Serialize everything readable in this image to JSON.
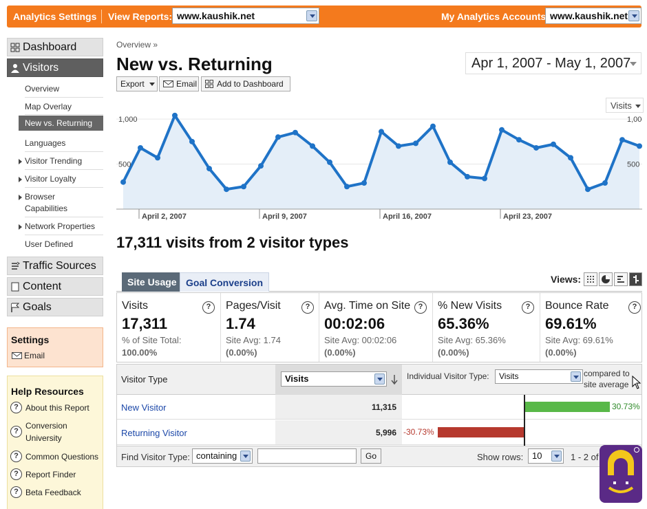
{
  "topbar": {
    "analytics_settings": "Analytics Settings",
    "view_reports_label": "View Reports:",
    "view_reports_value": "www.kaushik.net",
    "accounts_label": "My Analytics Accounts:",
    "accounts_value": "www.kaushik.net"
  },
  "sidebar": {
    "dashboard": "Dashboard",
    "visitors": "Visitors",
    "sub_items": [
      {
        "label": "Overview"
      },
      {
        "label": "Map Overlay"
      },
      {
        "label": "New vs. Returning"
      },
      {
        "label": "Languages"
      },
      {
        "label": "Visitor Trending"
      },
      {
        "label": "Visitor Loyalty"
      },
      {
        "label": "Browser"
      },
      {
        "label": "Capabilities"
      },
      {
        "label": "Network Properties"
      },
      {
        "label": "User Defined"
      }
    ],
    "traffic_sources": "Traffic Sources",
    "content": "Content",
    "goals": "Goals",
    "settings_title": "Settings",
    "settings_email": "Email",
    "help_title": "Help Resources",
    "help_items": [
      "About this Report",
      "Conversion",
      "University",
      "Common Questions",
      "Report Finder",
      "Beta Feedback"
    ]
  },
  "main": {
    "breadcrumb": "Overview »",
    "title": "New vs. Returning",
    "date_range": "Apr 1, 2007 - May 1, 2007",
    "toolbar": {
      "export": "Export",
      "email": "Email",
      "add_dashboard": "Add to Dashboard"
    },
    "chart_metric": "Visits",
    "summary": "17,311 visits from 2 visitor types"
  },
  "chart_data": {
    "type": "area",
    "x": [
      "2007-04-01",
      "2007-04-02",
      "2007-04-03",
      "2007-04-04",
      "2007-04-05",
      "2007-04-06",
      "2007-04-07",
      "2007-04-08",
      "2007-04-09",
      "2007-04-10",
      "2007-04-11",
      "2007-04-12",
      "2007-04-13",
      "2007-04-14",
      "2007-04-15",
      "2007-04-16",
      "2007-04-17",
      "2007-04-18",
      "2007-04-19",
      "2007-04-20",
      "2007-04-21",
      "2007-04-22",
      "2007-04-23",
      "2007-04-24",
      "2007-04-25",
      "2007-04-26",
      "2007-04-27",
      "2007-04-28",
      "2007-04-29",
      "2007-04-30",
      "2007-05-01"
    ],
    "values": [
      300,
      680,
      570,
      1040,
      750,
      450,
      220,
      250,
      480,
      800,
      850,
      700,
      520,
      250,
      290,
      860,
      700,
      730,
      920,
      520,
      360,
      340,
      880,
      770,
      680,
      720,
      570,
      220,
      290,
      770,
      700
    ],
    "x_ticks": [
      "April 2, 2007",
      "April 9, 2007",
      "April 16, 2007",
      "April 23, 2007"
    ],
    "y_ticks": [
      "1,000",
      "500"
    ],
    "ylim": [
      0,
      1100
    ],
    "colors": {
      "line": "#1f73c7",
      "fill": "#e4eef8"
    }
  },
  "tabs": {
    "site_usage": "Site Usage",
    "goal_conversion": "Goal Conversion",
    "views_label": "Views:"
  },
  "metrics": [
    {
      "name": "Visits",
      "value": "17,311",
      "sub1": "% of Site Total:",
      "sub2": "100.00%"
    },
    {
      "name": "Pages/Visit",
      "value": "1.74",
      "sub1": "Site Avg: 1.74",
      "sub2": "(0.00%)"
    },
    {
      "name": "Avg. Time on Site",
      "value": "00:02:06",
      "sub1": "Site Avg: 00:02:06",
      "sub2": "(0.00%)"
    },
    {
      "name": "% New Visits",
      "value": "65.36%",
      "sub1": "Site Avg: 65.36%",
      "sub2": "(0.00%)"
    },
    {
      "name": "Bounce Rate",
      "value": "69.61%",
      "sub1": "Site Avg: 69.61%",
      "sub2": "(0.00%)"
    }
  ],
  "table": {
    "col_visitor_type": "Visitor Type",
    "col_metric": "Visits",
    "individual_label": "Individual Visitor Type:",
    "individual_value": "Visits",
    "compared_1": "compared to",
    "compared_2": "site average",
    "rows": [
      {
        "name": "New Visitor",
        "visits": "11,315",
        "pct_label": "30.73%",
        "pct": 30.73
      },
      {
        "name": "Returning Visitor",
        "visits": "5,996",
        "pct_label": "-30.73%",
        "pct": -30.73
      }
    ],
    "find_label": "Find Visitor Type:",
    "find_mode": "containing",
    "go": "Go",
    "show_rows_label": "Show rows:",
    "show_rows_value": "10",
    "pagination": "1 - 2 of"
  }
}
